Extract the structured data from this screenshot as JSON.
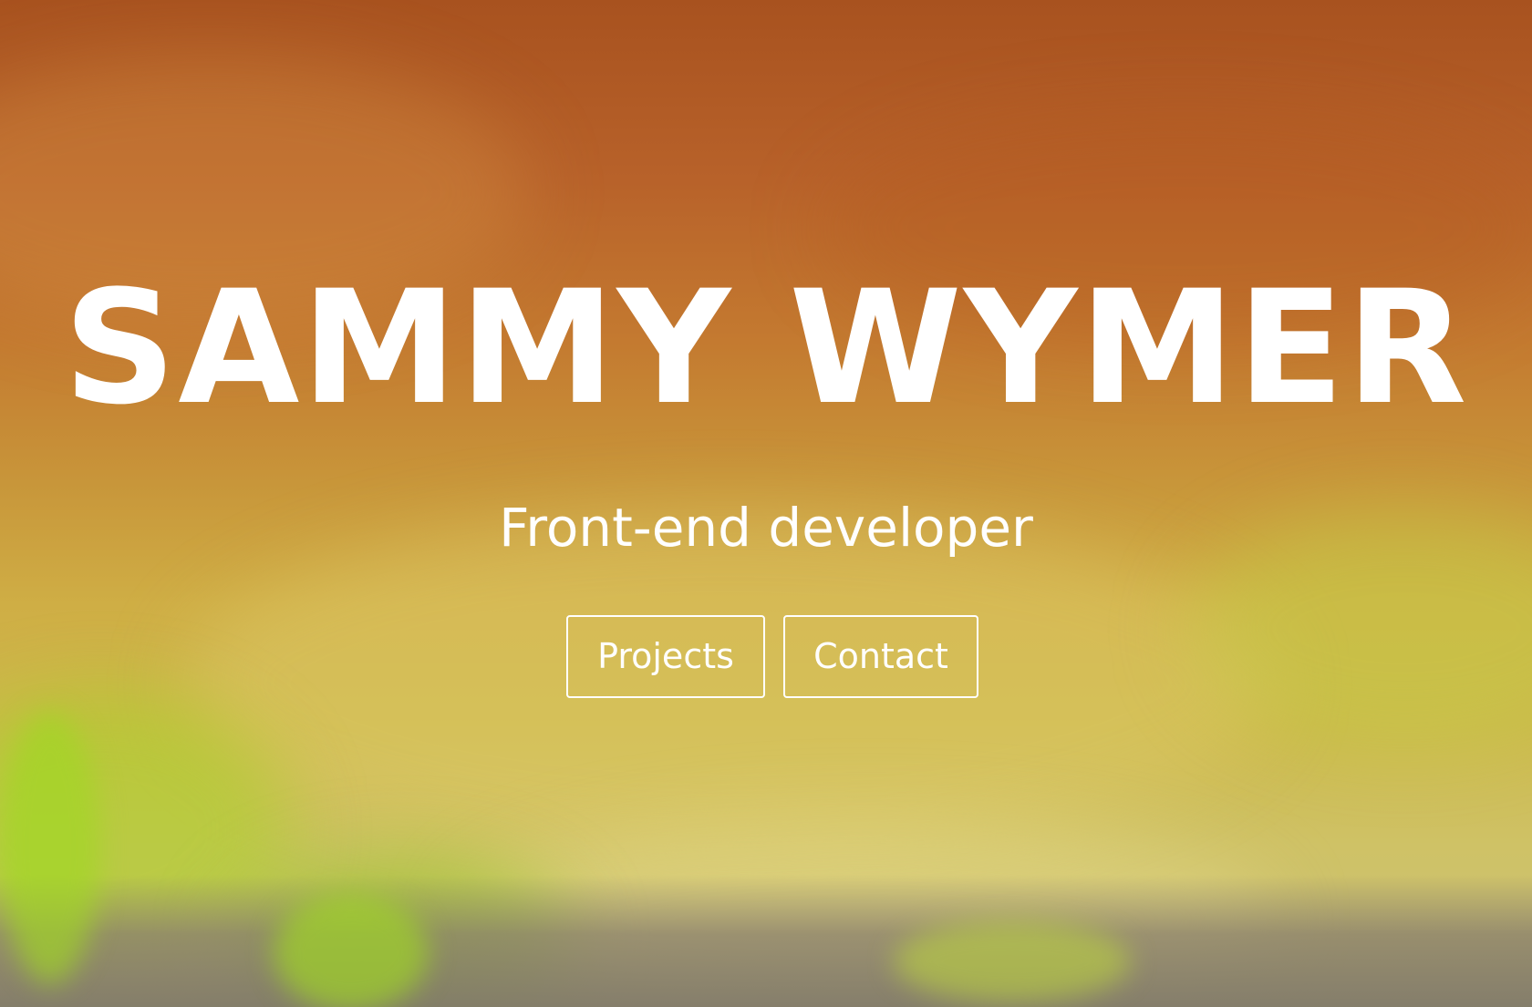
{
  "hero": {
    "name": "SAMMY WYMER",
    "role": "Front-end developer"
  },
  "buttons": {
    "projects_label": "Projects",
    "contact_label": "Contact"
  },
  "colors": {
    "text": "#ffffff",
    "background_top": "#a8521f",
    "background_bottom": "#c9c27a",
    "accent_green": "#a0d723"
  }
}
